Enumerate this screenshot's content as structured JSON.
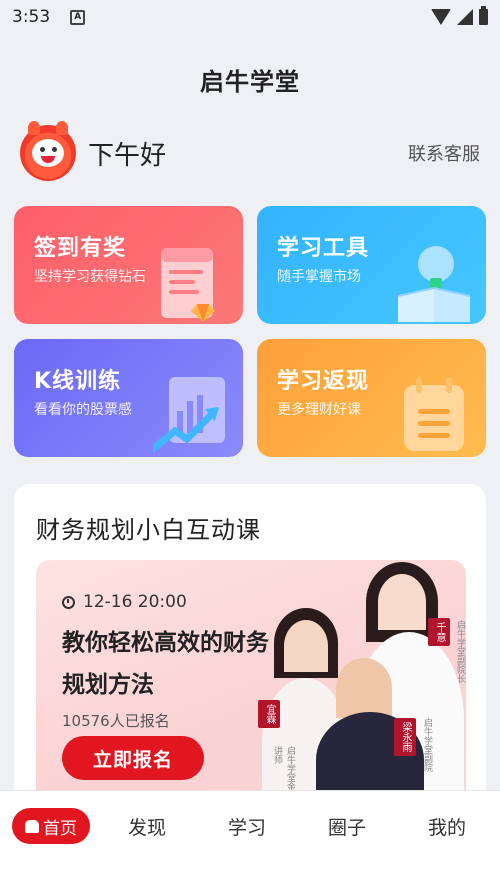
{
  "status_bar": {
    "time": "3:53",
    "notification_icon": "A"
  },
  "app": {
    "title": "启牛学堂"
  },
  "header": {
    "greeting": "下午好",
    "service_link": "联系客服"
  },
  "tiles": [
    {
      "title": "签到有奖",
      "subtitle": "坚持学习获得钻石",
      "icon": "calendar-gem-icon",
      "color": "#ff6470"
    },
    {
      "title": "学习工具",
      "subtitle": "随手掌握市场",
      "icon": "book-bulb-icon",
      "color": "#3cbcff"
    },
    {
      "title": "K线训练",
      "subtitle": "看看你的股票感",
      "icon": "chart-arrow-icon",
      "color": "#7776f8"
    },
    {
      "title": "学习返现",
      "subtitle": "更多理财好课",
      "icon": "calendar-list-icon",
      "color": "#ffad44"
    }
  ],
  "course": {
    "heading": "财务规划小白互动课",
    "time": "12-16 20:00",
    "title": "教你轻松高效的财务规划方法",
    "count": "10576人已报名",
    "button": "立即报名",
    "teachers": [
      {
        "name": "宜霖",
        "role": "启牛学堂金牌讲师"
      },
      {
        "name": "千意",
        "role": "启牛学堂副院长"
      },
      {
        "name": "梁永雨",
        "role": "启牛学堂副院"
      }
    ]
  },
  "tabbar": {
    "items": [
      {
        "label": "首页",
        "active": true
      },
      {
        "label": "发现"
      },
      {
        "label": "学习"
      },
      {
        "label": "圈子"
      },
      {
        "label": "我的"
      }
    ]
  }
}
